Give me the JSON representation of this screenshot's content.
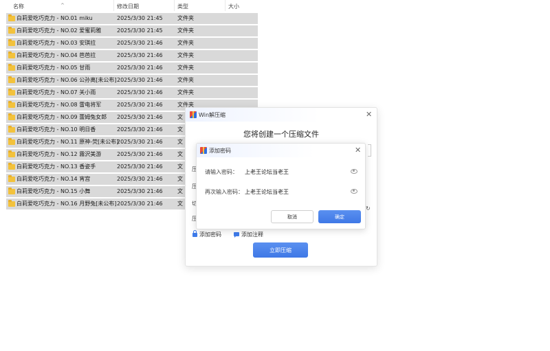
{
  "explorer": {
    "columns": {
      "name": "名称",
      "date": "修改日期",
      "type": "类型",
      "size": "大小"
    },
    "rows": [
      {
        "name": "白莉爱吃巧克力 - NO.01 miku",
        "date": "2025/3/30 21:45",
        "type": "文件夹"
      },
      {
        "name": "白莉爱吃巧克力 - NO.02 爱蜜莉雅",
        "date": "2025/3/30 21:45",
        "type": "文件夹"
      },
      {
        "name": "白莉爱吃巧克力 - NO.03 安琪拉",
        "date": "2025/3/30 21:46",
        "type": "文件夹"
      },
      {
        "name": "白莉爱吃巧克力 - NO.04 芭芭拉",
        "date": "2025/3/30 21:46",
        "type": "文件夹"
      },
      {
        "name": "白莉爱吃巧克力 - NO.05 甘雨",
        "date": "2025/3/30 21:46",
        "type": "文件夹"
      },
      {
        "name": "白莉爱吃巧克力 - NO.06 公孙离[未公布]",
        "date": "2025/3/30 21:46",
        "type": "文件夹"
      },
      {
        "name": "白莉爱吃巧克力 - NO.07 关小雨",
        "date": "2025/3/30 21:46",
        "type": "文件夹"
      },
      {
        "name": "白莉爱吃巧克力 - NO.08 雷电将军",
        "date": "2025/3/30 21:46",
        "type": "文件夹"
      },
      {
        "name": "白莉爱吃巧克力 - NO.09 蕾姆兔女郎",
        "date": "2025/3/30 21:46",
        "type": "文"
      },
      {
        "name": "白莉爱吃巧克力 - NO.10 明日香",
        "date": "2025/3/30 21:46",
        "type": "文"
      },
      {
        "name": "白莉爱吃巧克力 - NO.11 原神-荧[未公布]",
        "date": "2025/3/30 21:46",
        "type": "文"
      },
      {
        "name": "白莉爱吃巧克力 - NO.12 霧沢美游",
        "date": "2025/3/30 21:46",
        "type": "文"
      },
      {
        "name": "白莉爱吃巧克力 - NO.13 香姿手",
        "date": "2025/3/30 21:46",
        "type": "文"
      },
      {
        "name": "白莉爱吃巧克力 - NO.14 宵宫",
        "date": "2025/3/30 21:46",
        "type": "文"
      },
      {
        "name": "白莉爱吃巧克力 - NO.15 小舞",
        "date": "2025/3/30 21:46",
        "type": "文"
      },
      {
        "name": "白莉爱吃巧克力 - NO.16 月野兔[未公布]",
        "date": "2025/3/30 21:46",
        "type": "文"
      }
    ]
  },
  "compress_dialog": {
    "title": "Win解压缩",
    "heading": "您将创建一个压缩文件",
    "partial_labels": [
      "压",
      "压",
      "切",
      "压"
    ],
    "add_password": "添加密码",
    "add_comment": "添加注释",
    "compress_button": "立即压缩"
  },
  "password_dialog": {
    "title": "添加密码",
    "enter_label": "请输入密码：",
    "enter_value": "上老王论坛当老王",
    "reenter_label": "再次输入密码：",
    "reenter_value": "上老王论坛当老王",
    "cancel": "取消",
    "ok": "确定"
  },
  "colors": {
    "accent": "#3f78e6",
    "row_selected": "#d9d9d9",
    "folder": "#f3c23c"
  }
}
